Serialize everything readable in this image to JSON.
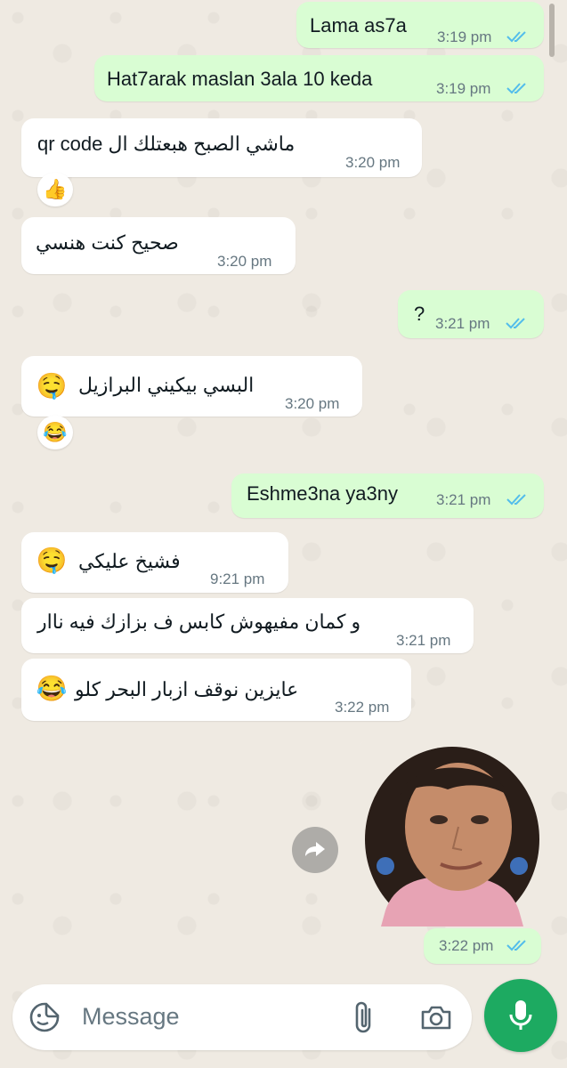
{
  "colors": {
    "outgoing_bubble": "#d9fdd3",
    "incoming_bubble": "#ffffff",
    "chat_background": "#efeae2",
    "read_ticks": "#53bdeb",
    "mic_button": "#1daa61"
  },
  "messages": [
    {
      "direction": "out",
      "text": "Lama as7a",
      "time": "3:19 pm"
    },
    {
      "direction": "out",
      "text": "Hat7arak maslan 3ala 10 keda",
      "time": "3:19 pm"
    },
    {
      "direction": "in",
      "text": "ماشي الصبح هبعتلك ال qr code",
      "time": "3:20 pm",
      "reaction": "👍"
    },
    {
      "direction": "in",
      "text": "صحيح كنت هنسي",
      "time": "3:20 pm"
    },
    {
      "direction": "out",
      "text": "?",
      "time": "3:21 pm"
    },
    {
      "direction": "in",
      "text": "البسي بيكيني البرازيل",
      "emoji": "🤤",
      "time": "3:20 pm",
      "reaction": "😂"
    },
    {
      "direction": "out",
      "text": "Eshme3na ya3ny",
      "time": "3:21 pm"
    },
    {
      "direction": "in",
      "text": "فشيخ عليكي",
      "emoji": "🤤",
      "time": "9:21 pm"
    },
    {
      "direction": "in",
      "text": "و كمان مفيهوش كابس ف بزازك فيه ناار",
      "time": "3:21 pm"
    },
    {
      "direction": "in",
      "text": "عايزين نوقف ازبار البحر كلو",
      "emoji": "😂",
      "time": "3:22 pm"
    },
    {
      "direction": "out",
      "type": "sticker",
      "time": "3:22 pm"
    }
  ],
  "input": {
    "placeholder": "Message"
  },
  "icons": {
    "emoji": "sticker-smiley-icon",
    "attach": "paperclip-icon",
    "camera": "camera-icon",
    "mic": "microphone-icon",
    "forward": "forward-icon",
    "read_receipt": "double-check-icon"
  }
}
